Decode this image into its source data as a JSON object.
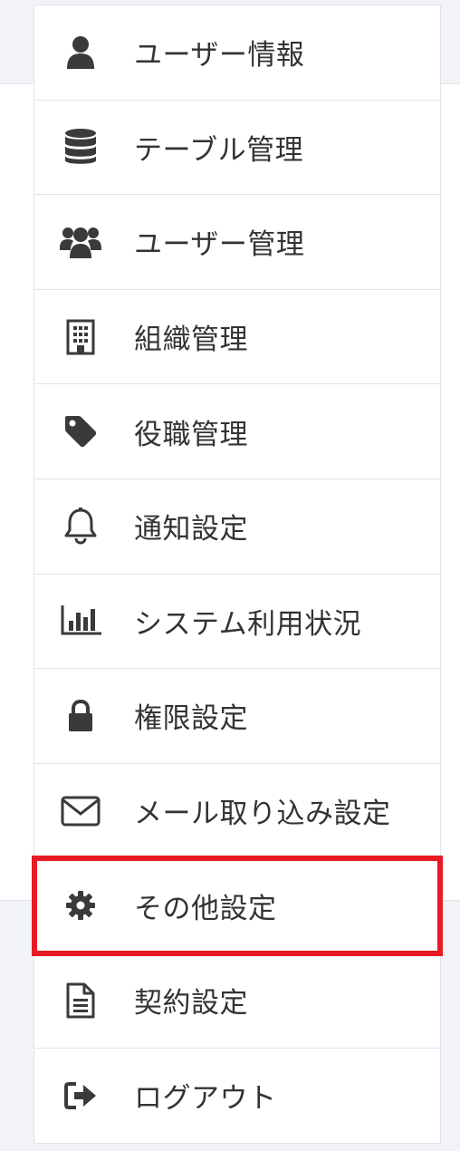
{
  "menu": {
    "items": [
      {
        "label": "ユーザー情報",
        "icon": "user-icon"
      },
      {
        "label": "テーブル管理",
        "icon": "database-icon"
      },
      {
        "label": "ユーザー管理",
        "icon": "users-icon"
      },
      {
        "label": "組織管理",
        "icon": "building-icon"
      },
      {
        "label": "役職管理",
        "icon": "tag-icon"
      },
      {
        "label": "通知設定",
        "icon": "bell-icon"
      },
      {
        "label": "システム利用状況",
        "icon": "bar-chart-icon"
      },
      {
        "label": "権限設定",
        "icon": "lock-icon"
      },
      {
        "label": "メール取り込み設定",
        "icon": "envelope-icon"
      },
      {
        "label": "その他設定",
        "icon": "gear-icon",
        "highlighted": true
      },
      {
        "label": "契約設定",
        "icon": "document-icon"
      },
      {
        "label": "ログアウト",
        "icon": "sign-out-icon"
      }
    ]
  },
  "colors": {
    "highlight": "#e81b24",
    "icon": "#3a3a3a",
    "text": "#333333",
    "border": "#dfe3ea",
    "background": "#f1f3f7"
  }
}
